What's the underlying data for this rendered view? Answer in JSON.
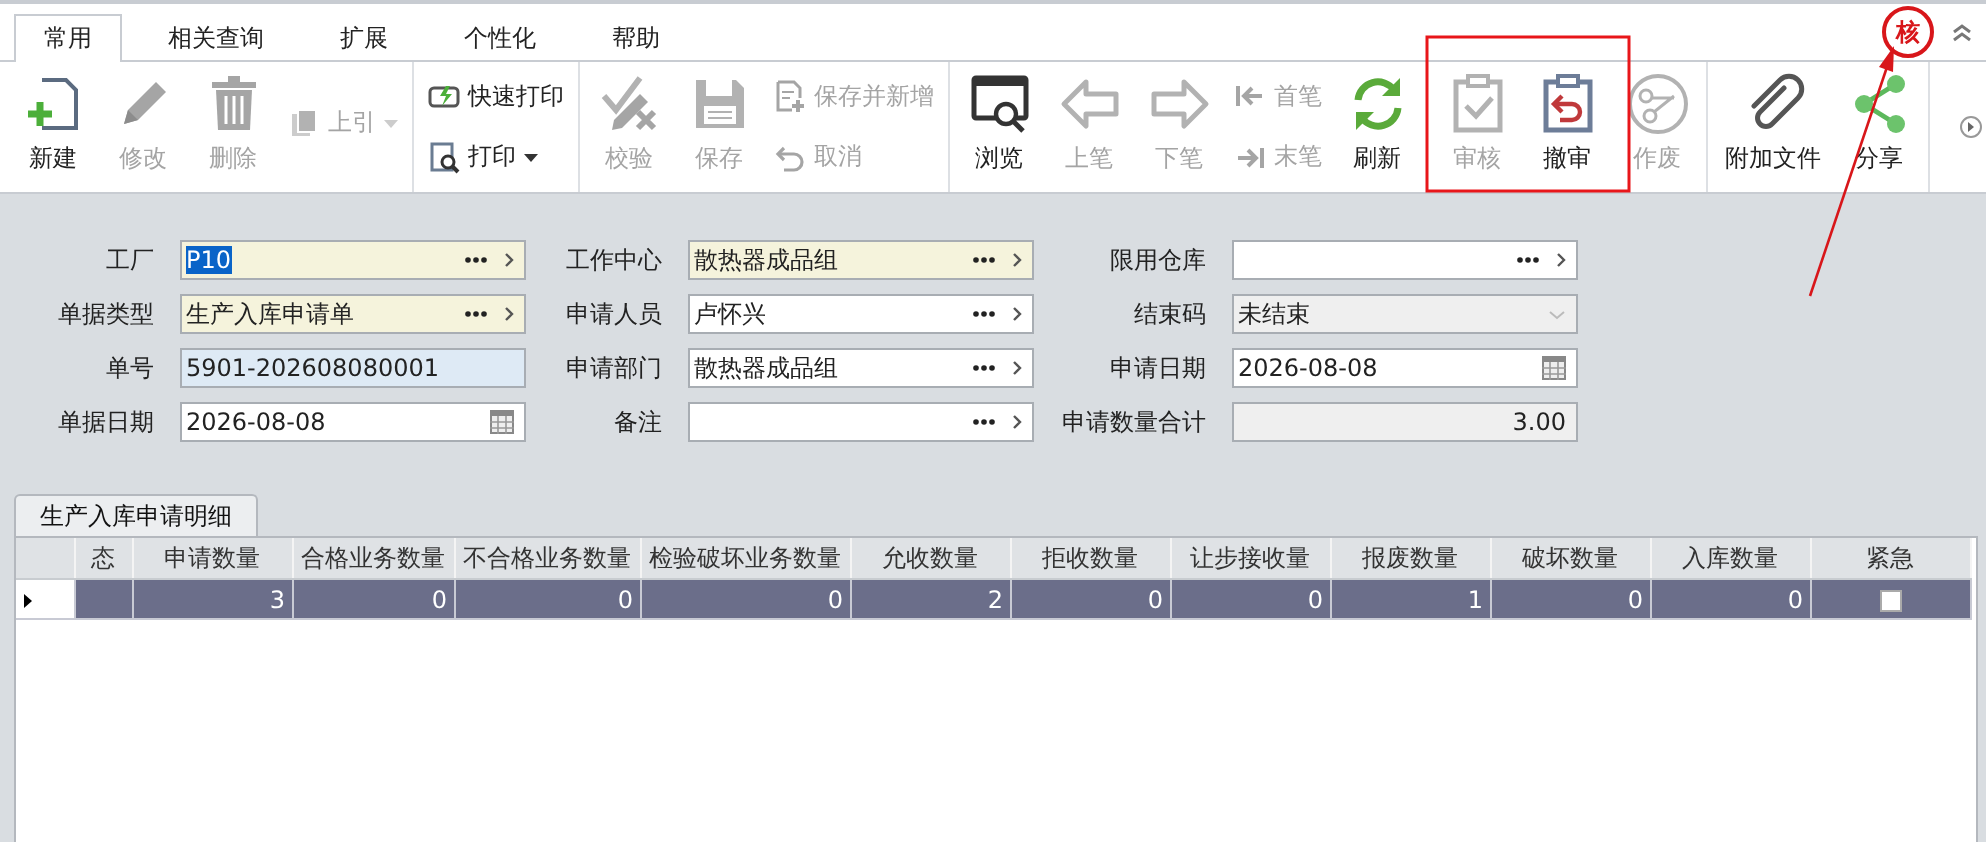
{
  "tabs": [
    {
      "label": "常用",
      "selected": true
    },
    {
      "label": "相关查询",
      "selected": false
    },
    {
      "label": "扩展",
      "selected": false
    },
    {
      "label": "个性化",
      "selected": false
    },
    {
      "label": "帮助",
      "selected": false
    }
  ],
  "audit_stamp": "核",
  "toolbar": [
    {
      "items": [
        {
          "kind": "big",
          "label": "新建",
          "disabled": false
        },
        {
          "kind": "big",
          "label": "修改",
          "disabled": true
        },
        {
          "kind": "big",
          "label": "删除",
          "disabled": true
        },
        {
          "kind": "dropdown",
          "label": "上引",
          "disabled": true
        }
      ]
    },
    {
      "items": [
        {
          "kind": "stack",
          "items": [
            {
              "label": "快速打印",
              "disabled": false,
              "dropdown": false
            },
            {
              "label": "打印",
              "disabled": false,
              "dropdown": true
            }
          ]
        }
      ]
    },
    {
      "items": [
        {
          "kind": "big",
          "label": "校验",
          "disabled": true
        },
        {
          "kind": "big",
          "label": "保存",
          "disabled": true
        },
        {
          "kind": "stack",
          "items": [
            {
              "label": "保存并新增",
              "disabled": true,
              "dropdown": false
            },
            {
              "label": "取消",
              "disabled": true,
              "dropdown": false
            }
          ]
        }
      ]
    },
    {
      "items": [
        {
          "kind": "big",
          "label": "浏览",
          "disabled": false
        },
        {
          "kind": "big",
          "label": "上笔",
          "disabled": true
        },
        {
          "kind": "big",
          "label": "下笔",
          "disabled": true
        },
        {
          "kind": "stack",
          "items": [
            {
              "label": "首笔",
              "disabled": true,
              "dropdown": false
            },
            {
              "label": "末笔",
              "disabled": true,
              "dropdown": false
            }
          ]
        },
        {
          "kind": "big",
          "label": "刷新",
          "disabled": false
        }
      ]
    },
    {
      "items": [
        {
          "kind": "big",
          "label": "审核",
          "disabled": true
        },
        {
          "kind": "big",
          "label": "撤审",
          "disabled": false
        },
        {
          "kind": "big",
          "label": "作废",
          "disabled": true
        }
      ]
    },
    {
      "items": [
        {
          "kind": "big",
          "label": "附加文件",
          "disabled": false
        },
        {
          "kind": "big",
          "label": "分享",
          "disabled": false
        }
      ]
    }
  ],
  "form": {
    "fields": [
      {
        "label": "工厂",
        "value": "P10",
        "kind": "lookup",
        "required": true,
        "disabled": false,
        "value_selected": true
      },
      {
        "label": "工作中心",
        "value": "散热器成品组",
        "kind": "lookup",
        "required": true,
        "disabled": false
      },
      {
        "label": "限用仓库",
        "kind": "lookup",
        "required": false,
        "disabled": false
      },
      {
        "label": "单据类型",
        "value": "生产入库申请单",
        "kind": "lookup",
        "required": true,
        "disabled": false
      },
      {
        "label": "申请人员",
        "value": "卢怀兴",
        "kind": "lookup",
        "required": false,
        "disabled": false
      },
      {
        "label": "结束码",
        "value": "未结束",
        "kind": "select",
        "required": false,
        "disabled": true
      },
      {
        "label": "单号",
        "value": "5901-202608080001",
        "kind": "readonly",
        "required": false,
        "disabled": false
      },
      {
        "label": "申请部门",
        "value": "散热器成品组",
        "kind": "lookup",
        "required": false,
        "disabled": false
      },
      {
        "label": "申请日期",
        "value": "2026-08-08",
        "kind": "date",
        "required": false,
        "disabled": false
      },
      {
        "label": "单据日期",
        "value": "2026-08-08",
        "kind": "date",
        "required": false,
        "disabled": false
      },
      {
        "label": "备注",
        "kind": "lookup",
        "required": false,
        "disabled": false
      },
      {
        "label": "申请数量合计",
        "value": "3.00",
        "kind": "number",
        "required": false,
        "disabled": true
      }
    ]
  },
  "detail": {
    "tabs": [
      {
        "label": "生产入库申请明细",
        "selected": true
      }
    ],
    "columns": [
      {
        "label": "态",
        "kind": "status"
      },
      {
        "label": "申请数量",
        "kind": "number"
      },
      {
        "label": "合格业务数量",
        "kind": "number"
      },
      {
        "label": "不合格业务数量",
        "kind": "number"
      },
      {
        "label": "检验破坏业务数量",
        "kind": "number"
      },
      {
        "label": "允收数量",
        "kind": "number"
      },
      {
        "label": "拒收数量",
        "kind": "number"
      },
      {
        "label": "让步接收量",
        "kind": "number"
      },
      {
        "label": "报废数量",
        "kind": "number"
      },
      {
        "label": "破坏数量",
        "kind": "number"
      },
      {
        "label": "入库数量",
        "kind": "number"
      },
      {
        "label": "紧急",
        "kind": "check"
      }
    ],
    "rows": [
      {
        "selected": true,
        "values": [
          "3",
          "0",
          "0",
          "0",
          "2",
          "0",
          "0",
          "1",
          "0",
          "0"
        ],
        "urgent": false
      }
    ]
  }
}
